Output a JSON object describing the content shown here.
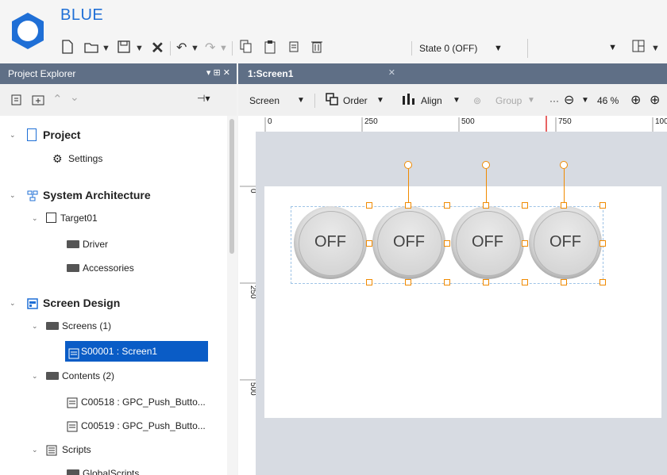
{
  "app": {
    "title": "BLUE"
  },
  "toolbar": {
    "icons": [
      "new-icon",
      "open-icon",
      "save-icon",
      "delete-x-icon",
      "undo-icon",
      "redo-icon",
      "copy-icon",
      "paste-icon",
      "duplicate-icon",
      "trash-icon"
    ],
    "state_value": "State 0 (OFF)"
  },
  "explorer": {
    "title": "Project Explorer",
    "tree": {
      "project": "Project",
      "settings": "Settings",
      "system_architecture": "System Architecture",
      "target": "Target01",
      "driver": "Driver",
      "accessories": "Accessories",
      "screen_design": "Screen Design",
      "screens": "Screens (1)",
      "screen1": "S00001 : Screen1",
      "contents": "Contents (2)",
      "content1": "C00518 : GPC_Push_Butto...",
      "content2": "C00519 : GPC_Push_Butto...",
      "scripts": "Scripts",
      "global_scripts": "GlobalScripts"
    }
  },
  "document": {
    "tab_title": "1:Screen1",
    "toolbar": {
      "screen": "Screen",
      "order": "Order",
      "align": "Align",
      "group": "Group",
      "more": "···",
      "zoom": "46 %"
    },
    "ruler_top": [
      "0",
      "250",
      "500",
      "750",
      "100"
    ],
    "ruler_left": [
      "0",
      "250",
      "500"
    ]
  },
  "canvas": {
    "buttons": [
      {
        "label": "OFF"
      },
      {
        "label": "OFF"
      },
      {
        "label": "OFF"
      },
      {
        "label": "OFF"
      }
    ]
  },
  "colors": {
    "accent": "#1f6fd6",
    "panel_header": "#5f6f86",
    "selection": "#0a5cc6",
    "handle": "#f08a00"
  }
}
